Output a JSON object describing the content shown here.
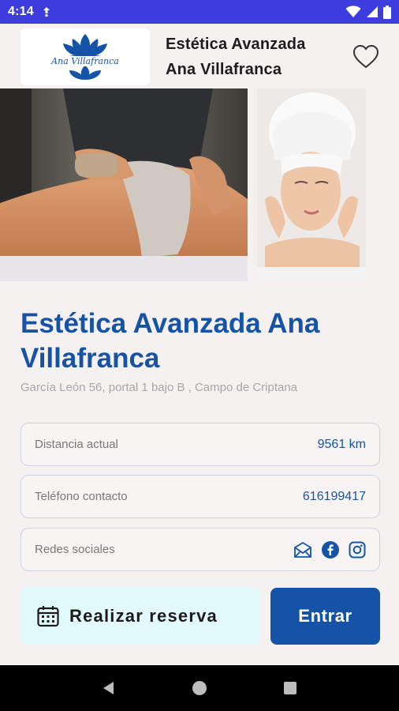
{
  "status_bar": {
    "time": "4:14"
  },
  "business": {
    "logo_text": "Ana Villafranca",
    "header_title_line1": "Estética Avanzada",
    "header_title_line2": "Ana Villafranca",
    "name": "Estética Avanzada Ana Villafranca",
    "address": "García León 56, portal 1 bajo B , Campo de Criptana"
  },
  "info_rows": {
    "distance": {
      "label": "Distancia actual",
      "value": "9561 km"
    },
    "phone": {
      "label": "Teléfono contacto",
      "value": "616199417"
    },
    "social": {
      "label": "Redes sociales",
      "icons": [
        "mail-icon",
        "facebook-icon",
        "instagram-icon"
      ]
    }
  },
  "actions": {
    "reserve_label": "Realizar reserva",
    "enter_label": "Entrar"
  },
  "icons": {
    "favorite": "heart-outline-icon",
    "calendar": "calendar-icon"
  },
  "colors": {
    "accent": "#1553a6",
    "status_bar": "#3d3ddf",
    "reserve_bg": "#e2fafd",
    "row_border": "#c9d3e6"
  }
}
